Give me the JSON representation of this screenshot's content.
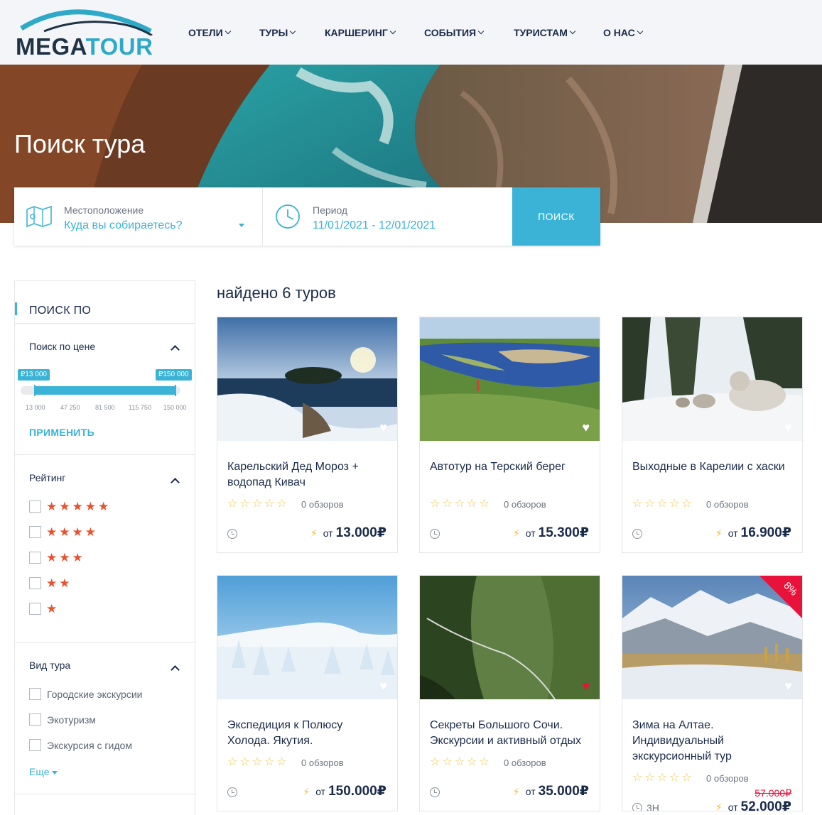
{
  "brand": {
    "part1": "MEGA",
    "part2": "TOUR"
  },
  "nav": [
    {
      "label": "ОТЕЛИ"
    },
    {
      "label": "ТУРЫ"
    },
    {
      "label": "КАРШЕРИНГ"
    },
    {
      "label": "СОБЫТИЯ"
    },
    {
      "label": "ТУРИСТАМ"
    },
    {
      "label": "О НАС"
    }
  ],
  "hero": {
    "title": "Поиск тура"
  },
  "search": {
    "location_label": "Местоположение",
    "location_value": "Куда вы собираетесь?",
    "period_label": "Период",
    "period_value": "11/01/2021 - 12/01/2021",
    "button": "ПОИСК"
  },
  "sidebar": {
    "title": "ПОИСК ПО",
    "price": {
      "title": "Поиск по цене",
      "min_tag": "₽13 000",
      "max_tag": "₽150 000",
      "ticks": [
        "13 000",
        "47 250",
        "81 500",
        "115 750",
        "150 000"
      ],
      "apply": "ПРИМЕНИТЬ"
    },
    "rating": {
      "title": "Рейтинг",
      "options": [
        5,
        4,
        3,
        2,
        1
      ]
    },
    "tour_type": {
      "title": "Вид тура",
      "options": [
        "Городские экскурсии",
        "Экотуризм",
        "Экскурсия с гидом"
      ],
      "more": "Еще"
    }
  },
  "results": {
    "found": "найдено 6 туров",
    "cards": [
      {
        "title": "Карельский Дед Мороз + водопад Кивач",
        "reviews": "0 обзоров",
        "from": "от",
        "price": "13.000₽",
        "favorite": false
      },
      {
        "title": "Автотур на Терский берег",
        "reviews": "0 обзоров",
        "from": "от",
        "price": "15.300₽",
        "favorite": false
      },
      {
        "title": "Выходные в Карелии с хаски",
        "reviews": "0 обзоров",
        "from": "от",
        "price": "16.900₽",
        "favorite": false
      },
      {
        "title": "Экспедиция к Полюсу Холода. Якутия.",
        "reviews": "0 обзоров",
        "from": "от",
        "price": "150.000₽",
        "favorite": false
      },
      {
        "title": "Секреты Большого Сочи. Экскурсии и активный отдых",
        "reviews": "0 обзоров",
        "from": "от",
        "price": "35.000₽",
        "favorite": true
      },
      {
        "title": "Зима на Алтае. Индивидуальный экскурсионный тур",
        "reviews": "0 обзоров",
        "from": "от",
        "price": "52.000₽",
        "old_price": "57.000₽",
        "duration": "3Н",
        "discount": "8%",
        "favorite": false
      }
    ]
  },
  "colors": {
    "accent": "#3ab3d6",
    "star_rating": "#e8522e",
    "star_card": "#f6c544",
    "sale": "#e8123a"
  }
}
